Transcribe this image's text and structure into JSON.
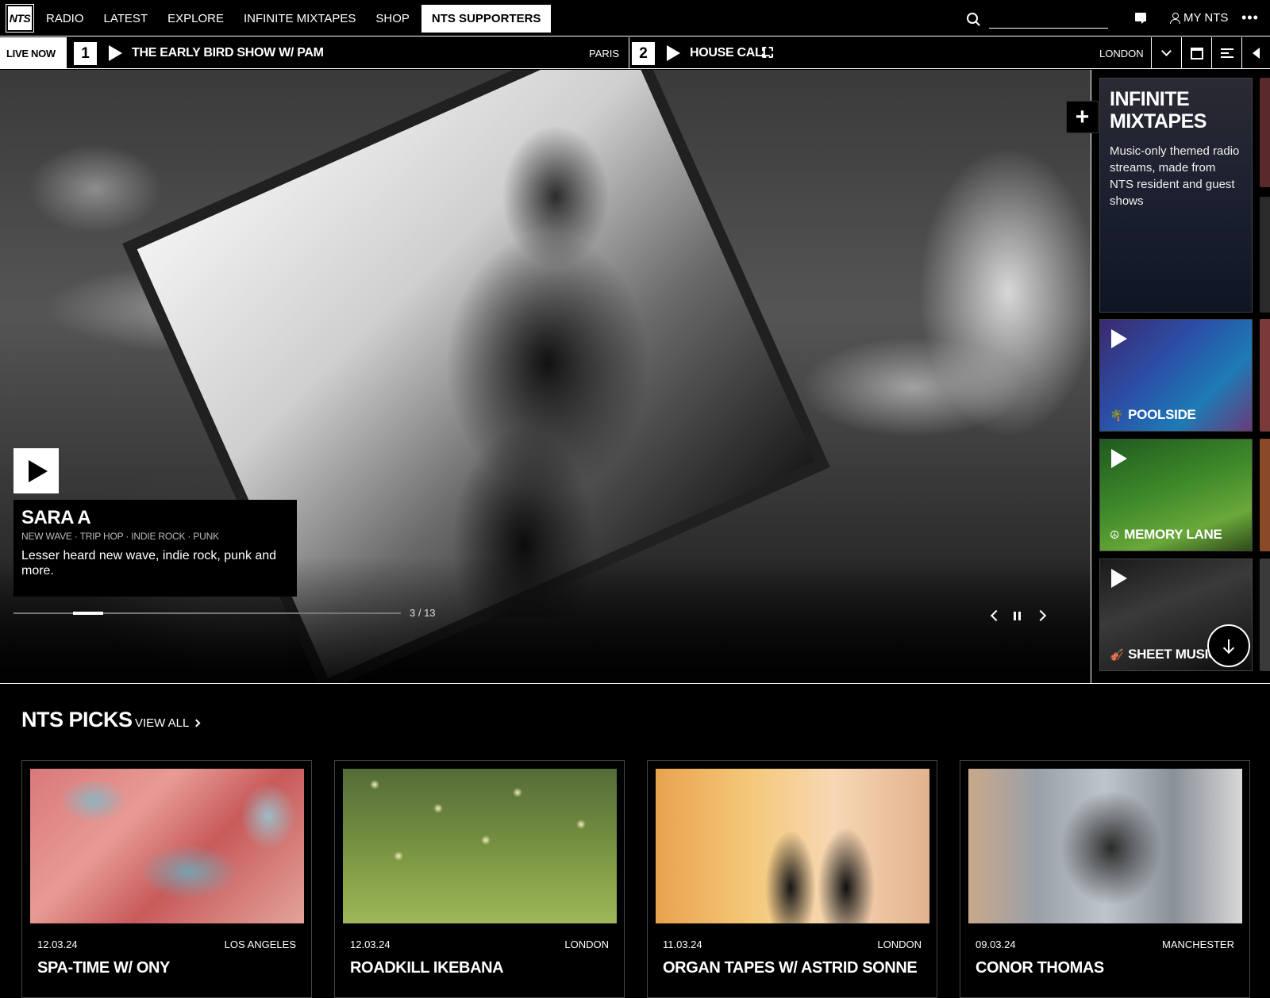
{
  "nav": {
    "logo": "NTS",
    "links": [
      "RADIO",
      "LATEST",
      "EXPLORE",
      "INFINITE MIXTAPES",
      "SHOP"
    ],
    "supporters": "NTS SUPPORTERS",
    "search_placeholder": "",
    "my_nts": "MY NTS",
    "more": "•••"
  },
  "live": {
    "label": "LIVE NOW",
    "channels": [
      {
        "number": "1",
        "title": "THE EARLY BIRD SHOW W/ PAM",
        "city": "PARIS"
      },
      {
        "number": "2",
        "title": "HOUSE CALL",
        "city": "LONDON"
      }
    ]
  },
  "hero": {
    "title": "SARA A",
    "genres": "NEW WAVE · TRIP HOP · INDIE ROCK · PUNK",
    "description": "Lesser heard new wave, indie rock, punk and more.",
    "slide_counter": "3 / 13",
    "slide_progress": 0.077
  },
  "mixtapes": {
    "title": "INFINITE MIXTAPES",
    "description": "Music-only themed radio streams, made from NTS resident and guest shows",
    "items": [
      {
        "name": "POOLSIDE",
        "icon": "palm-tree-icon",
        "glyph": "🌴"
      },
      {
        "name": "MEMORY LANE",
        "icon": "peace-icon",
        "glyph": "☮"
      },
      {
        "name": "SHEET MUSIC",
        "icon": "instrument-icon",
        "glyph": "🎻"
      }
    ]
  },
  "picks": {
    "heading": "NTS PICKS",
    "view_all": "VIEW ALL",
    "items": [
      {
        "date": "12.03.24",
        "city": "LOS ANGELES",
        "title": "SPA-TIME W/ ONY"
      },
      {
        "date": "12.03.24",
        "city": "LONDON",
        "title": "ROADKILL IKEBANA"
      },
      {
        "date": "11.03.24",
        "city": "LONDON",
        "title": "ORGAN TAPES W/ ASTRID SONNE"
      },
      {
        "date": "09.03.24",
        "city": "MANCHESTER",
        "title": "CONOR THOMAS"
      }
    ]
  },
  "colors": {
    "background": "#000000",
    "foreground": "#ffffff",
    "muted": "#bbbbbb"
  }
}
